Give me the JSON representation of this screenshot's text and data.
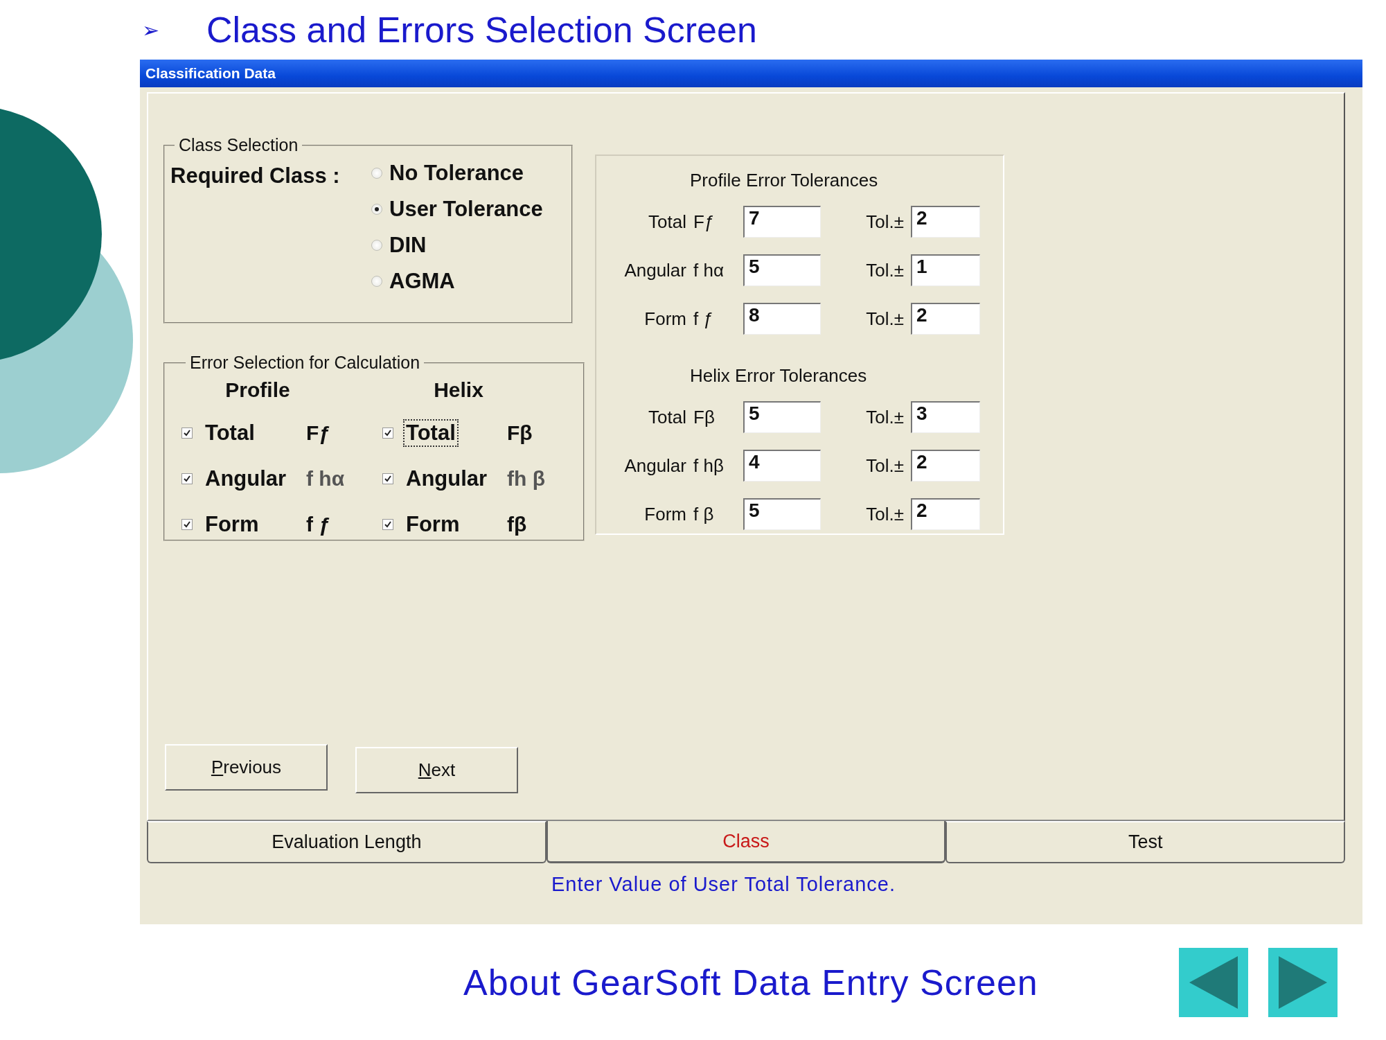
{
  "slide_title": {
    "bullet": "➢",
    "text": "Class and Errors Selection Screen"
  },
  "window": {
    "title": "Classification Data"
  },
  "class_selection": {
    "legend": "Class Selection",
    "label": "Required Class :",
    "options": [
      {
        "label": "No  Tolerance",
        "selected": false
      },
      {
        "label": "User  Tolerance",
        "selected": true
      },
      {
        "label": "DIN",
        "selected": false
      },
      {
        "label": "AGMA",
        "selected": false
      }
    ]
  },
  "error_selection": {
    "legend": "Error Selection for Calculation",
    "columns": [
      {
        "heading": "Profile",
        "items": [
          {
            "label": "Total",
            "symbol": "Fƒ",
            "muted": false,
            "checked": true,
            "focused": false
          },
          {
            "label": "Angular",
            "symbol": "f hα",
            "muted": true,
            "checked": true,
            "focused": false
          },
          {
            "label": "Form",
            "symbol": "f ƒ",
            "muted": false,
            "checked": true,
            "focused": false
          }
        ]
      },
      {
        "heading": "Helix",
        "items": [
          {
            "label": "Total",
            "symbol": "Fβ",
            "muted": false,
            "checked": true,
            "focused": true
          },
          {
            "label": "Angular",
            "symbol": "fh β",
            "muted": true,
            "checked": true,
            "focused": false
          },
          {
            "label": "Form",
            "symbol": "fβ",
            "muted": false,
            "checked": true,
            "focused": false
          }
        ]
      }
    ]
  },
  "tolerances": [
    {
      "heading": "Profile Error Tolerances",
      "rows": [
        {
          "label": "Total",
          "symbol": "Fƒ",
          "value": "7",
          "tol_label": "Tol.±",
          "tol_value": "2"
        },
        {
          "label": "Angular",
          "symbol": "f hα",
          "value": "5",
          "tol_label": "Tol.±",
          "tol_value": "1"
        },
        {
          "label": "Form",
          "symbol": "f ƒ",
          "value": "8",
          "tol_label": "Tol.±",
          "tol_value": "2"
        }
      ]
    },
    {
      "heading": "Helix Error Tolerances",
      "rows": [
        {
          "label": "Total",
          "symbol": "Fβ",
          "value": "5",
          "tol_label": "Tol.±",
          "tol_value": "3"
        },
        {
          "label": "Angular",
          "symbol": "f hβ",
          "value": "4",
          "tol_label": "Tol.±",
          "tol_value": "2"
        },
        {
          "label": "Form",
          "symbol": "f β",
          "value": "5",
          "tol_label": "Tol.±",
          "tol_value": "2"
        }
      ]
    }
  ],
  "buttons": [
    "Previous",
    "Next"
  ],
  "tabs": [
    {
      "label": "Evaluation Length",
      "selected": false
    },
    {
      "label": "Class",
      "selected": true
    },
    {
      "label": "Test",
      "selected": false
    }
  ],
  "status": "Enter Value of User Total Tolerance.",
  "footer": {
    "text": "About GearSoft Data Entry Screen"
  }
}
